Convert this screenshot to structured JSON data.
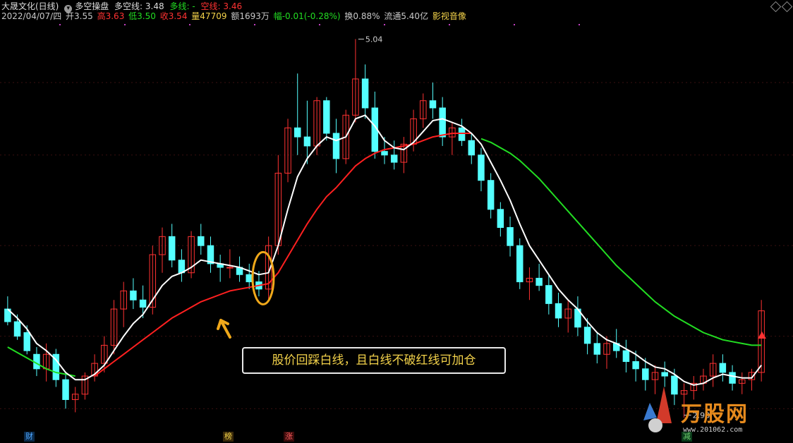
{
  "header": {
    "stock": "大晟文化(日线)",
    "indicator": "多空操盘",
    "dk_label": "多空线:",
    "dk_value": "3.48",
    "long_label": "多线:",
    "long_value": "-",
    "short_label": "空线:",
    "short_value": "3.46",
    "date": "2022/04/07/四",
    "open": "开3.55",
    "high": "高3.63",
    "low": "低3.50",
    "close": "收3.54",
    "volume": "量47709",
    "amount": "额1693万",
    "change": "幅-0.01(-0.28%)",
    "turnover": "换0.88%",
    "float": "流通5.40亿",
    "sector": "影视音像"
  },
  "callout_text": "股价回踩白线，且白线不破红线可加仓",
  "markers": [
    "财",
    "榜",
    "涨",
    "减"
  ],
  "logo": {
    "name": "万股网",
    "url": "www.201062.com"
  },
  "colors": {
    "up": "#ff3232",
    "down": "#54ffff",
    "white_line": "#ffffff",
    "red_line": "#ff2020",
    "green_line": "#22dd22",
    "callout": "#f3d24a",
    "circle": "#f0a81a"
  },
  "chart_data": {
    "type": "candlestick",
    "title": "",
    "ylim": [
      2.9,
      5.1
    ],
    "y_labels": {
      "max": "5.04",
      "min": "2.98"
    },
    "candles": [
      [
        3.55,
        3.62,
        3.46,
        3.48
      ],
      [
        3.48,
        3.52,
        3.38,
        3.4
      ],
      [
        3.42,
        3.46,
        3.3,
        3.32
      ],
      [
        3.3,
        3.34,
        3.18,
        3.22
      ],
      [
        3.22,
        3.36,
        3.15,
        3.3
      ],
      [
        3.3,
        3.33,
        3.12,
        3.16
      ],
      [
        3.16,
        3.2,
        3.0,
        3.05
      ],
      [
        3.05,
        3.12,
        2.98,
        3.08
      ],
      [
        3.08,
        3.2,
        3.05,
        3.18
      ],
      [
        3.18,
        3.3,
        3.15,
        3.25
      ],
      [
        3.25,
        3.4,
        3.2,
        3.35
      ],
      [
        3.35,
        3.6,
        3.3,
        3.55
      ],
      [
        3.55,
        3.7,
        3.45,
        3.65
      ],
      [
        3.65,
        3.72,
        3.55,
        3.6
      ],
      [
        3.6,
        3.68,
        3.5,
        3.56
      ],
      [
        3.56,
        3.9,
        3.52,
        3.85
      ],
      [
        3.85,
        4.0,
        3.75,
        3.95
      ],
      [
        3.95,
        4.02,
        3.78,
        3.82
      ],
      [
        3.82,
        3.88,
        3.7,
        3.75
      ],
      [
        3.75,
        3.98,
        3.72,
        3.95
      ],
      [
        3.95,
        4.02,
        3.85,
        3.9
      ],
      [
        3.9,
        3.95,
        3.75,
        3.8
      ],
      [
        3.8,
        3.85,
        3.7,
        3.78
      ],
      [
        3.78,
        3.88,
        3.72,
        3.78
      ],
      [
        3.78,
        3.84,
        3.7,
        3.74
      ],
      [
        3.74,
        3.8,
        3.66,
        3.7
      ],
      [
        3.7,
        3.76,
        3.62,
        3.66
      ],
      [
        3.66,
        3.95,
        3.6,
        3.9
      ],
      [
        3.9,
        4.4,
        3.85,
        4.3
      ],
      [
        4.3,
        4.6,
        4.25,
        4.55
      ],
      [
        4.55,
        4.85,
        4.4,
        4.5
      ],
      [
        4.5,
        4.7,
        4.35,
        4.45
      ],
      [
        4.45,
        4.72,
        4.4,
        4.7
      ],
      [
        4.7,
        4.72,
        4.48,
        4.52
      ],
      [
        4.52,
        4.6,
        4.3,
        4.38
      ],
      [
        4.38,
        4.65,
        4.35,
        4.62
      ],
      [
        4.62,
        5.04,
        4.58,
        4.82
      ],
      [
        4.82,
        4.9,
        4.6,
        4.66
      ],
      [
        4.66,
        4.75,
        4.38,
        4.42
      ],
      [
        4.42,
        4.5,
        4.35,
        4.4
      ],
      [
        4.4,
        4.48,
        4.32,
        4.36
      ],
      [
        4.36,
        4.5,
        4.3,
        4.46
      ],
      [
        4.46,
        4.65,
        4.42,
        4.6
      ],
      [
        4.6,
        4.74,
        4.55,
        4.7
      ],
      [
        4.7,
        4.8,
        4.6,
        4.66
      ],
      [
        4.66,
        4.72,
        4.45,
        4.5
      ],
      [
        4.5,
        4.58,
        4.4,
        4.55
      ],
      [
        4.55,
        4.6,
        4.45,
        4.48
      ],
      [
        4.48,
        4.52,
        4.35,
        4.4
      ],
      [
        4.4,
        4.44,
        4.2,
        4.26
      ],
      [
        4.26,
        4.3,
        4.05,
        4.1
      ],
      [
        4.1,
        4.14,
        3.95,
        4.0
      ],
      [
        4.0,
        4.06,
        3.84,
        3.9
      ],
      [
        3.9,
        3.94,
        3.66,
        3.7
      ],
      [
        3.7,
        3.78,
        3.6,
        3.72
      ],
      [
        3.72,
        3.8,
        3.65,
        3.68
      ],
      [
        3.68,
        3.74,
        3.52,
        3.58
      ],
      [
        3.58,
        3.64,
        3.45,
        3.5
      ],
      [
        3.5,
        3.6,
        3.42,
        3.55
      ],
      [
        3.55,
        3.62,
        3.4,
        3.45
      ],
      [
        3.45,
        3.5,
        3.3,
        3.36
      ],
      [
        3.36,
        3.42,
        3.25,
        3.3
      ],
      [
        3.3,
        3.4,
        3.22,
        3.36
      ],
      [
        3.36,
        3.44,
        3.28,
        3.32
      ],
      [
        3.32,
        3.38,
        3.2,
        3.26
      ],
      [
        3.26,
        3.32,
        3.15,
        3.22
      ],
      [
        3.22,
        3.28,
        3.1,
        3.16
      ],
      [
        3.16,
        3.24,
        3.08,
        3.2
      ],
      [
        3.2,
        3.26,
        3.12,
        3.18
      ],
      [
        3.18,
        3.22,
        3.02,
        3.08
      ],
      [
        3.08,
        3.14,
        2.95,
        3.1
      ],
      [
        3.1,
        3.18,
        3.05,
        3.14
      ],
      [
        3.14,
        3.22,
        3.1,
        3.18
      ],
      [
        3.18,
        3.3,
        3.12,
        3.25
      ],
      [
        3.25,
        3.3,
        3.15,
        3.2
      ],
      [
        3.2,
        3.24,
        3.1,
        3.14
      ],
      [
        3.14,
        3.2,
        3.08,
        3.16
      ],
      [
        3.16,
        3.22,
        3.1,
        3.2
      ],
      [
        3.2,
        3.6,
        3.15,
        3.54
      ]
    ],
    "white_line": [
      3.55,
      3.5,
      3.44,
      3.36,
      3.32,
      3.27,
      3.2,
      3.16,
      3.16,
      3.19,
      3.24,
      3.32,
      3.4,
      3.47,
      3.52,
      3.6,
      3.68,
      3.73,
      3.75,
      3.78,
      3.82,
      3.81,
      3.8,
      3.79,
      3.78,
      3.76,
      3.74,
      3.75,
      3.9,
      4.1,
      4.28,
      4.38,
      4.45,
      4.5,
      4.48,
      4.5,
      4.6,
      4.62,
      4.56,
      4.48,
      4.44,
      4.43,
      4.47,
      4.53,
      4.59,
      4.6,
      4.58,
      4.56,
      4.52,
      4.46,
      4.36,
      4.26,
      4.15,
      4.02,
      3.9,
      3.82,
      3.74,
      3.66,
      3.6,
      3.55,
      3.48,
      3.42,
      3.38,
      3.36,
      3.33,
      3.3,
      3.26,
      3.23,
      3.22,
      3.19,
      3.15,
      3.13,
      3.14,
      3.17,
      3.19,
      3.18,
      3.17,
      3.17,
      3.24
    ],
    "red_line": [
      null,
      null,
      null,
      null,
      null,
      null,
      null,
      null,
      null,
      3.18,
      3.22,
      3.26,
      3.3,
      3.34,
      3.38,
      3.42,
      3.46,
      3.5,
      3.53,
      3.56,
      3.59,
      3.61,
      3.63,
      3.65,
      3.66,
      3.67,
      3.68,
      3.69,
      3.75,
      3.84,
      3.93,
      4.02,
      4.1,
      4.17,
      4.22,
      4.28,
      4.34,
      4.38,
      4.41,
      4.43,
      4.44,
      4.45,
      4.46,
      4.48,
      4.5,
      4.51,
      4.52,
      4.52,
      4.52,
      null,
      null,
      null,
      null,
      null,
      null,
      null,
      null,
      null,
      null,
      null,
      null,
      null,
      null,
      null,
      null,
      null,
      null,
      null,
      null,
      null,
      null,
      null,
      null,
      null,
      null,
      null,
      null,
      null,
      3.3
    ],
    "green_line": [
      3.34,
      3.31,
      3.28,
      3.25,
      3.22,
      3.2,
      3.19,
      3.18,
      null,
      null,
      null,
      null,
      null,
      null,
      null,
      null,
      null,
      null,
      null,
      null,
      null,
      null,
      null,
      null,
      null,
      null,
      null,
      null,
      null,
      null,
      null,
      null,
      null,
      null,
      null,
      null,
      null,
      null,
      null,
      null,
      null,
      null,
      null,
      null,
      null,
      null,
      null,
      null,
      null,
      4.49,
      4.47,
      4.44,
      4.41,
      4.37,
      4.32,
      4.27,
      4.21,
      4.15,
      4.09,
      4.03,
      3.97,
      3.91,
      3.85,
      3.79,
      3.74,
      3.69,
      3.64,
      3.59,
      3.55,
      3.51,
      3.48,
      3.45,
      3.42,
      3.4,
      3.38,
      3.37,
      3.36,
      3.35,
      3.35
    ]
  }
}
